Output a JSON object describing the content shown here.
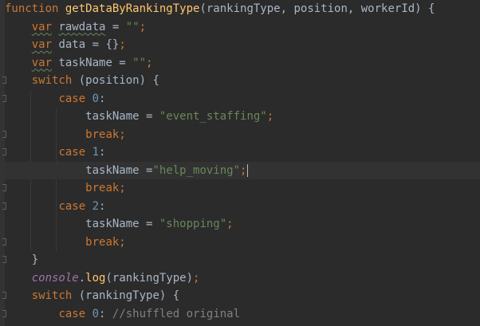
{
  "editor": {
    "theme": {
      "background": "#2b2b2b",
      "keyword": "#cc7832",
      "function": "#ffc66d",
      "string": "#6a8759",
      "number": "#6897bb",
      "object": "#9876aa",
      "comment": "#808080",
      "text": "#a9b7c6"
    },
    "lines": [
      {
        "tokens": [
          {
            "t": "function",
            "c": "kw"
          },
          {
            "t": " ",
            "c": "plain"
          },
          {
            "t": "getDataByRankingType",
            "c": "fn"
          },
          {
            "t": "(rankingType, position, workerId) {",
            "c": "plain"
          }
        ]
      },
      {
        "tokens": [
          {
            "t": "    ",
            "c": "plain"
          },
          {
            "t": "var",
            "c": "kw squig"
          },
          {
            "t": " ",
            "c": "plain"
          },
          {
            "t": "rawdata",
            "c": "plain squig"
          },
          {
            "t": " = ",
            "c": "plain"
          },
          {
            "t": "\"\"",
            "c": "str"
          },
          {
            "t": ";",
            "c": "kw"
          }
        ]
      },
      {
        "tokens": [
          {
            "t": "    ",
            "c": "plain"
          },
          {
            "t": "var",
            "c": "kw squig"
          },
          {
            "t": " data = {}",
            "c": "plain"
          },
          {
            "t": ";",
            "c": "kw"
          }
        ]
      },
      {
        "tokens": [
          {
            "t": "    ",
            "c": "plain"
          },
          {
            "t": "var",
            "c": "kw squig"
          },
          {
            "t": " taskName = ",
            "c": "plain"
          },
          {
            "t": "\"\"",
            "c": "str"
          },
          {
            "t": ";",
            "c": "kw"
          }
        ]
      },
      {
        "fold": true,
        "tokens": [
          {
            "t": "    ",
            "c": "plain"
          },
          {
            "t": "switch",
            "c": "kw"
          },
          {
            "t": " (position) {",
            "c": "plain"
          }
        ]
      },
      {
        "fold": true,
        "tokens": [
          {
            "t": "        ",
            "c": "plain"
          },
          {
            "t": "case",
            "c": "kw"
          },
          {
            "t": " ",
            "c": "plain"
          },
          {
            "t": "0",
            "c": "num"
          },
          {
            "t": ":",
            "c": "plain"
          }
        ]
      },
      {
        "tokens": [
          {
            "t": "            taskName = ",
            "c": "plain"
          },
          {
            "t": "\"event_staffing\"",
            "c": "str"
          },
          {
            "t": ";",
            "c": "kw"
          }
        ]
      },
      {
        "fold": true,
        "tokens": [
          {
            "t": "            ",
            "c": "plain"
          },
          {
            "t": "break;",
            "c": "kw"
          }
        ]
      },
      {
        "fold": true,
        "tokens": [
          {
            "t": "        ",
            "c": "plain"
          },
          {
            "t": "case",
            "c": "kw"
          },
          {
            "t": " ",
            "c": "plain"
          },
          {
            "t": "1",
            "c": "num"
          },
          {
            "t": ":",
            "c": "plain"
          }
        ]
      },
      {
        "current": true,
        "caret": true,
        "tokens": [
          {
            "t": "            taskName =",
            "c": "plain"
          },
          {
            "t": "\"help_moving\"",
            "c": "str"
          },
          {
            "t": ";",
            "c": "kw"
          }
        ]
      },
      {
        "fold": true,
        "tokens": [
          {
            "t": "            ",
            "c": "plain"
          },
          {
            "t": "break;",
            "c": "kw"
          }
        ]
      },
      {
        "fold": true,
        "tokens": [
          {
            "t": "        ",
            "c": "plain"
          },
          {
            "t": "case",
            "c": "kw"
          },
          {
            "t": " ",
            "c": "plain"
          },
          {
            "t": "2",
            "c": "num"
          },
          {
            "t": ":",
            "c": "plain"
          }
        ]
      },
      {
        "tokens": [
          {
            "t": "            taskName = ",
            "c": "plain"
          },
          {
            "t": "\"shopping\"",
            "c": "str"
          },
          {
            "t": ";",
            "c": "kw"
          }
        ]
      },
      {
        "fold": true,
        "tokens": [
          {
            "t": "            ",
            "c": "plain"
          },
          {
            "t": "break;",
            "c": "kw"
          }
        ]
      },
      {
        "fold": true,
        "tokens": [
          {
            "t": "    }",
            "c": "plain"
          }
        ]
      },
      {
        "tokens": [
          {
            "t": "    ",
            "c": "plain"
          },
          {
            "t": "console",
            "c": "obj"
          },
          {
            "t": ".",
            "c": "plain"
          },
          {
            "t": "log",
            "c": "fn"
          },
          {
            "t": "(rankingType)",
            "c": "plain"
          },
          {
            "t": ";",
            "c": "kw"
          }
        ]
      },
      {
        "fold": true,
        "tokens": [
          {
            "t": "    ",
            "c": "plain"
          },
          {
            "t": "switch",
            "c": "kw"
          },
          {
            "t": " (rankingType) {",
            "c": "plain"
          }
        ]
      },
      {
        "fold": true,
        "tokens": [
          {
            "t": "        ",
            "c": "plain"
          },
          {
            "t": "case",
            "c": "kw"
          },
          {
            "t": " ",
            "c": "plain"
          },
          {
            "t": "0",
            "c": "num"
          },
          {
            "t": ": ",
            "c": "plain"
          },
          {
            "t": "//shuffled original",
            "c": "cmt"
          }
        ]
      }
    ]
  }
}
